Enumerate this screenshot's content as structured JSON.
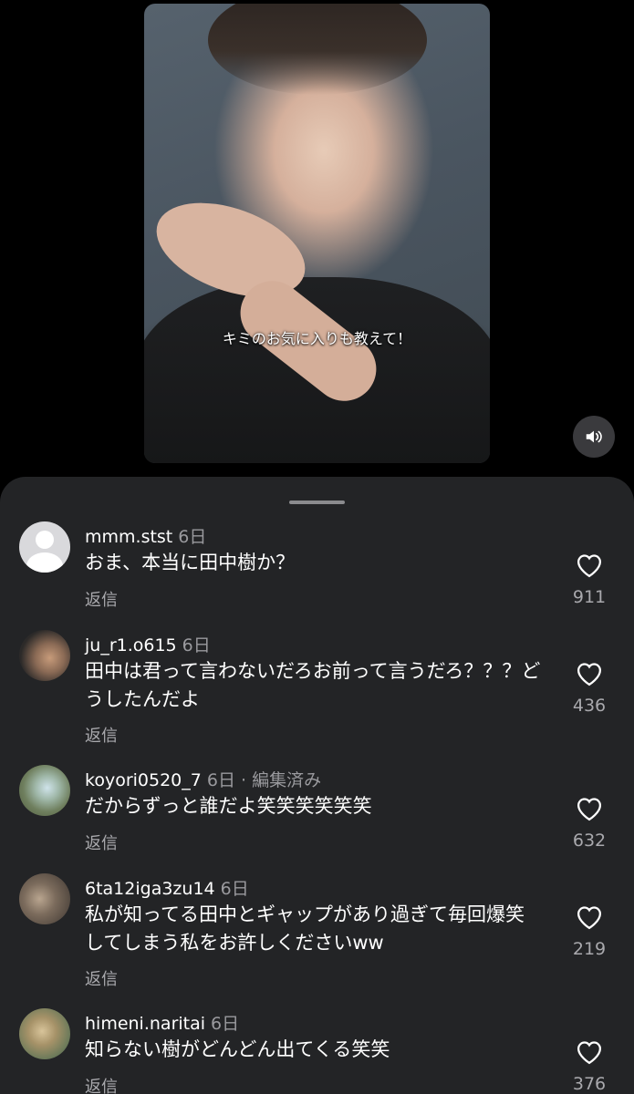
{
  "video": {
    "caption": "キミのお気に入りも教えて！",
    "mute_icon": "speaker-icon"
  },
  "comments": [
    {
      "username": "mmm.stst",
      "time": "6日",
      "edited": "",
      "text": "おま、本当に田中樹か？",
      "reply": "返信",
      "likes": "911",
      "avatar": "default-avatar"
    },
    {
      "username": "ju_r1.o615",
      "time": "6日",
      "edited": "",
      "text": "田中は君って言わないだろお前って言うだろ？？？どうしたんだよ",
      "reply": "返信",
      "likes": "436",
      "avatar": "photo-avatar"
    },
    {
      "username": "koyori0520_7",
      "time": "6日",
      "edited": "· 編集済み",
      "text": "だからずっと誰だよ笑笑笑笑笑笑",
      "reply": "返信",
      "likes": "632",
      "avatar": "photo-avatar"
    },
    {
      "username": "6ta12iga3zu14",
      "time": "6日",
      "edited": "",
      "text": "私が知ってる田中とギャップがあり過ぎて毎回爆笑してしまう私をお許しくださいww",
      "reply": "返信",
      "likes": "219",
      "avatar": "photo-avatar"
    },
    {
      "username": "himeni.naritai",
      "time": "6日",
      "edited": "",
      "text": "知らない樹がどんどん出てくる笑笑",
      "reply": "返信",
      "likes": "376",
      "avatar": "photo-avatar"
    }
  ]
}
